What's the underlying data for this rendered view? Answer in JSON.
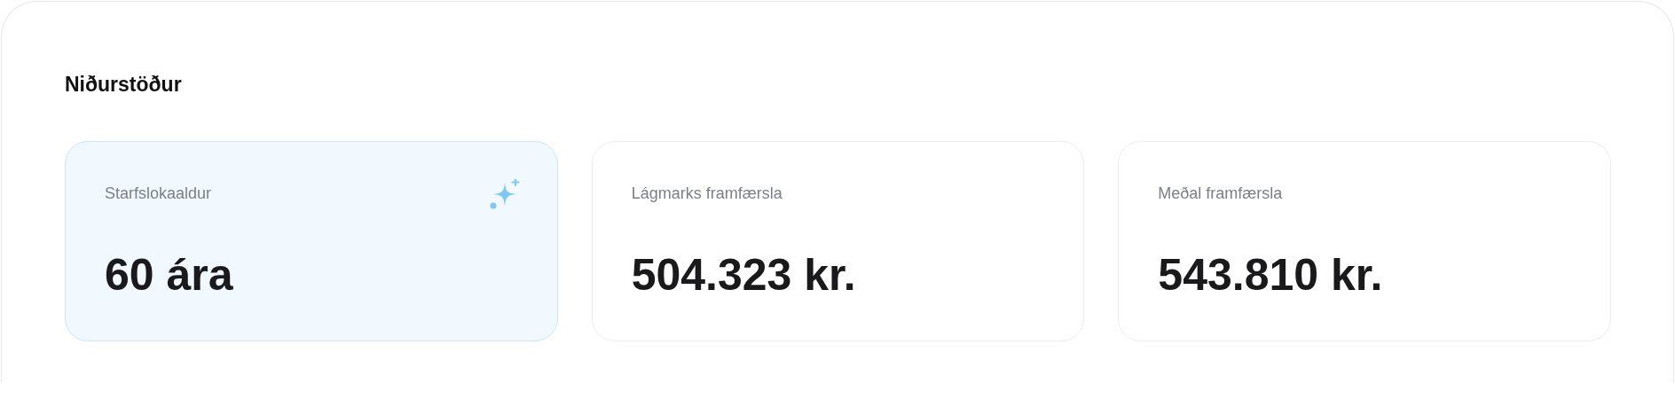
{
  "section": {
    "title": "Niðurstöður"
  },
  "cards": [
    {
      "label": "Starfslokaaldur",
      "value": "60 ára",
      "highlighted": true
    },
    {
      "label": "Lágmarks framfærsla",
      "value": "504.323 kr.",
      "highlighted": false
    },
    {
      "label": "Meðal framfærsla",
      "value": "543.810 kr.",
      "highlighted": false
    }
  ]
}
